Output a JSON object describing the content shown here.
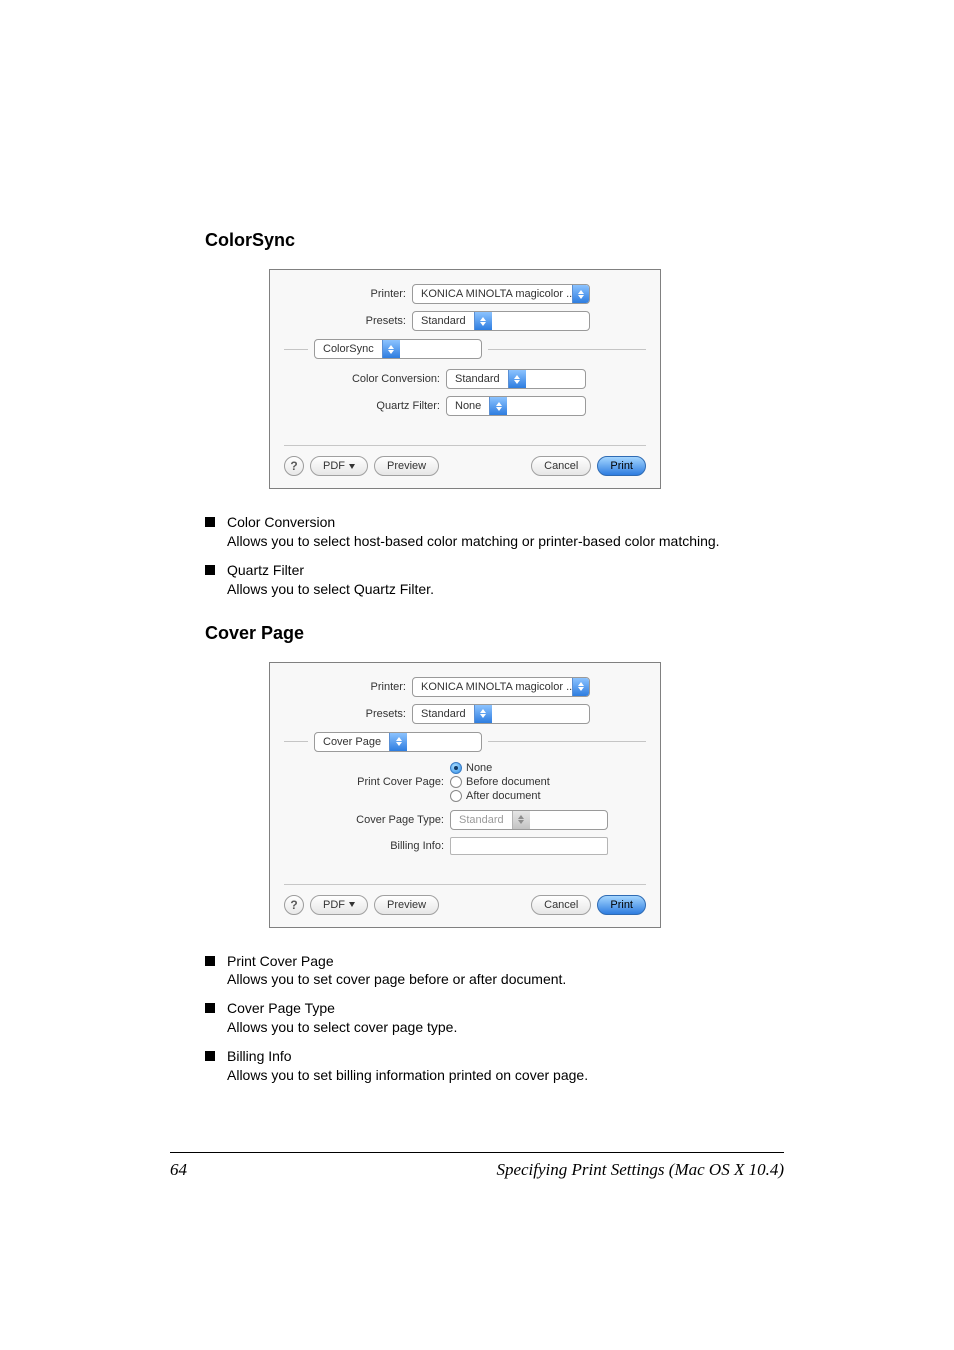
{
  "sections": {
    "colorsync": {
      "heading": "ColorSync",
      "dialog": {
        "printer_label": "Printer:",
        "printer_value": "KONICA MINOLTA magicolor ...",
        "presets_label": "Presets:",
        "presets_value": "Standard",
        "pane_value": "ColorSync",
        "cc_label": "Color Conversion:",
        "cc_value": "Standard",
        "qf_label": "Quartz Filter:",
        "qf_value": "None",
        "help_glyph": "?",
        "pdf_label": "PDF",
        "preview_label": "Preview",
        "cancel_label": "Cancel",
        "print_label": "Print"
      },
      "bullets": [
        {
          "title": "Color Conversion",
          "desc": "Allows you to select host-based color matching or printer-based color matching."
        },
        {
          "title": "Quartz Filter",
          "desc": "Allows you to select Quartz Filter."
        }
      ]
    },
    "coverpage": {
      "heading": "Cover Page",
      "dialog": {
        "printer_label": "Printer:",
        "printer_value": "KONICA MINOLTA magicolor ...",
        "presets_label": "Presets:",
        "presets_value": "Standard",
        "pane_value": "Cover Page",
        "pcp_label": "Print Cover Page:",
        "pcp_options": {
          "none": "None",
          "before": "Before document",
          "after": "After document"
        },
        "cpt_label": "Cover Page Type:",
        "cpt_value": "Standard",
        "billing_label": "Billing Info:",
        "help_glyph": "?",
        "pdf_label": "PDF",
        "preview_label": "Preview",
        "cancel_label": "Cancel",
        "print_label": "Print"
      },
      "bullets": [
        {
          "title": "Print Cover Page",
          "desc": "Allows you to set cover page before or after document."
        },
        {
          "title": "Cover Page Type",
          "desc": "Allows you to select cover page type."
        },
        {
          "title": "Billing Info",
          "desc": "Allows you to set billing information printed on cover page."
        }
      ]
    }
  },
  "footer": {
    "page_number": "64",
    "title": "Specifying Print Settings (Mac OS X 10.4)"
  }
}
